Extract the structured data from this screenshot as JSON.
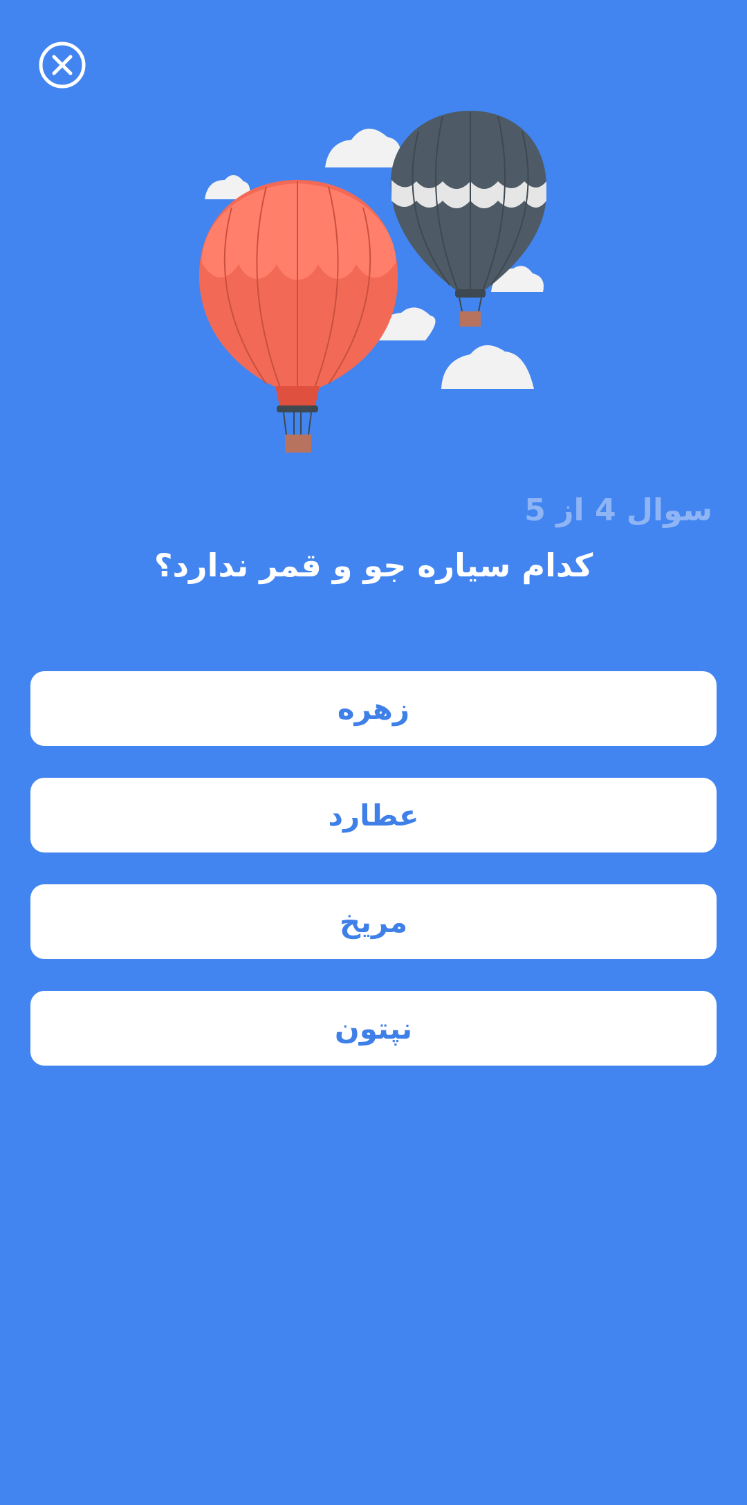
{
  "header": {
    "close_icon": "close-circle-icon"
  },
  "illustration": {
    "name": "hot-air-balloons-illustration",
    "colors": {
      "background": "#4285f0",
      "balloon_red": "#f26a55",
      "balloon_dark": "#4e5b66",
      "cloud": "#f2f2f2"
    }
  },
  "quiz": {
    "progress": "سوال 4 از 5",
    "question": "کدام سیاره جو و قمر ندارد؟",
    "options": [
      {
        "label": "زهره"
      },
      {
        "label": "عطارد"
      },
      {
        "label": "مریخ"
      },
      {
        "label": "نپتون"
      }
    ]
  }
}
